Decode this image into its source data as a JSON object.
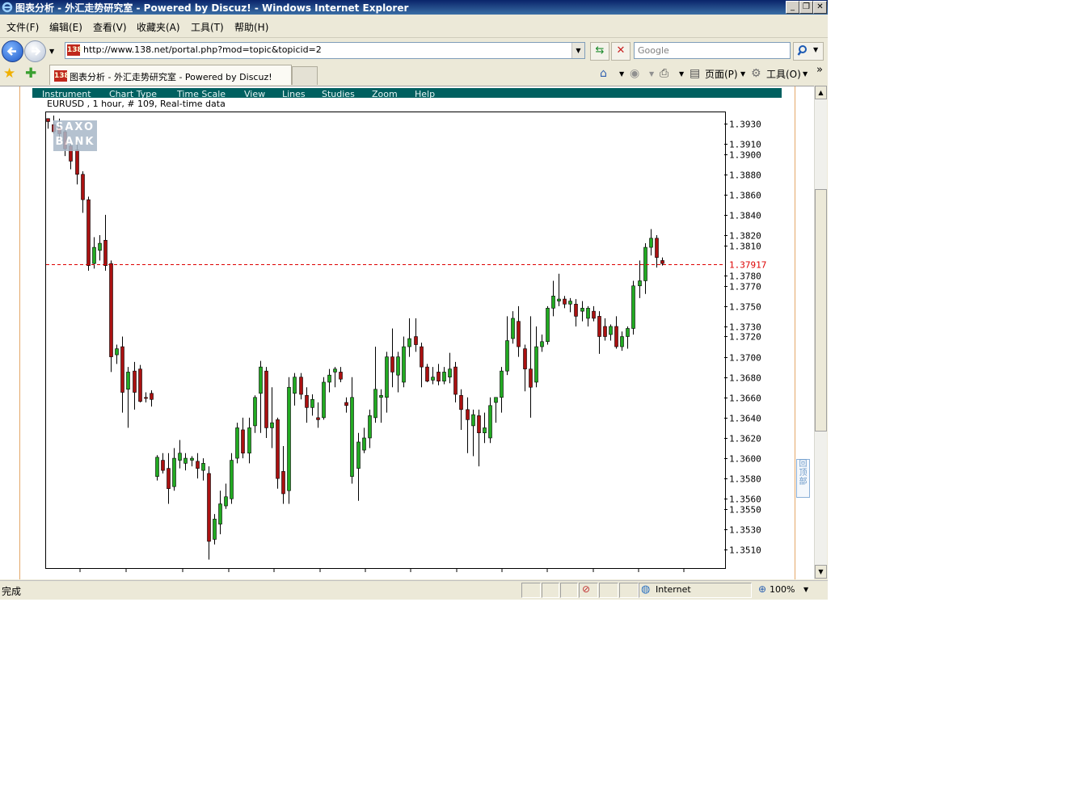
{
  "window": {
    "title": "图表分析 - 外汇走势研究室 - Powered by Discuz! - Windows Internet Explorer",
    "minimize": "_",
    "maximize": "❐",
    "close": "✕"
  },
  "menubar": {
    "items": [
      "文件(F)",
      "编辑(E)",
      "查看(V)",
      "收藏夹(A)",
      "工具(T)",
      "帮助(H)"
    ]
  },
  "address": {
    "favicon": "138",
    "url": "http://www.138.net/portal.php?mod=topic&topicid=2",
    "search_placeholder": "Google"
  },
  "tab": {
    "favicon": "138",
    "title": "图表分析 - 外汇走势研究室 - Powered by Discuz!"
  },
  "toolbar": {
    "page_label": "页面(P)",
    "tools_label": "工具(O)",
    "chevron": "»"
  },
  "icons": [
    "ie-icon",
    "back-arrow-icon",
    "forward-arrow-icon",
    "refresh-icon",
    "stop-icon",
    "search-icon",
    "favorites-star-icon",
    "add-favorites-icon",
    "home-icon",
    "feeds-icon",
    "print-icon",
    "page-icon",
    "gear-icon",
    "globe-icon",
    "zoom-icon"
  ],
  "chart_menu": [
    "Instrument",
    "Chart Type",
    "Time Scale",
    "View",
    "Lines",
    "Studies",
    "Zoom",
    "Help"
  ],
  "watermark": {
    "line1": "SAXO",
    "line2": "BANK"
  },
  "back_to_top": "回顶部",
  "status": {
    "text": "完成",
    "zone": "Internet",
    "zoom": "100%"
  },
  "colors": {
    "up": "#22aa22",
    "down": "#aa1111",
    "menu_bg": "#006060",
    "price_line": "#dd0000"
  },
  "chart_data": {
    "type": "candlestick",
    "title": "EURUSD , 1 hour, # 109, Real-time data",
    "ylim": [
      1.3497,
      1.3942
    ],
    "y_ticks": [
      "1.3930",
      "1.3910",
      "1.3900",
      "1.3880",
      "1.3860",
      "1.3840",
      "1.3820",
      "1.3810",
      "1.3780",
      "1.3770",
      "1.3750",
      "1.3730",
      "1.3720",
      "1.3700",
      "1.3680",
      "1.3660",
      "1.3640",
      "1.3620",
      "1.3600",
      "1.3580",
      "1.3560",
      "1.3550",
      "1.3530",
      "1.3510"
    ],
    "current_price": "1.37917",
    "candles": [
      {
        "o": 1.3935,
        "h": 1.3935,
        "l": 1.3925,
        "c": 1.3932
      },
      {
        "o": 1.3929,
        "h": 1.3938,
        "l": 1.392,
        "c": 1.3922
      },
      {
        "o": 1.3926,
        "h": 1.3935,
        "l": 1.3915,
        "c": 1.392
      },
      {
        "o": 1.3922,
        "h": 1.3924,
        "l": 1.3898,
        "c": 1.3905
      },
      {
        "o": 1.3908,
        "h": 1.391,
        "l": 1.3885,
        "c": 1.3893
      },
      {
        "o": 1.3904,
        "h": 1.3912,
        "l": 1.387,
        "c": 1.388
      },
      {
        "o": 1.388,
        "h": 1.3883,
        "l": 1.3842,
        "c": 1.3855
      },
      {
        "o": 1.3855,
        "h": 1.3858,
        "l": 1.3785,
        "c": 1.379
      },
      {
        "o": 1.3792,
        "h": 1.3818,
        "l": 1.3787,
        "c": 1.3808
      },
      {
        "o": 1.3805,
        "h": 1.382,
        "l": 1.3795,
        "c": 1.3812
      },
      {
        "o": 1.3815,
        "h": 1.384,
        "l": 1.3785,
        "c": 1.379
      },
      {
        "o": 1.3792,
        "h": 1.3795,
        "l": 1.3685,
        "c": 1.37
      },
      {
        "o": 1.3702,
        "h": 1.3712,
        "l": 1.3693,
        "c": 1.3708
      },
      {
        "o": 1.371,
        "h": 1.372,
        "l": 1.3645,
        "c": 1.3665
      },
      {
        "o": 1.3668,
        "h": 1.369,
        "l": 1.363,
        "c": 1.3685
      },
      {
        "o": 1.3686,
        "h": 1.3695,
        "l": 1.3648,
        "c": 1.3665
      },
      {
        "o": 1.3688,
        "h": 1.3692,
        "l": 1.3655,
        "c": 1.3656
      },
      {
        "o": 1.366,
        "h": 1.3665,
        "l": 1.3655,
        "c": 1.3659
      },
      {
        "o": 1.3664,
        "h": 1.3667,
        "l": 1.3651,
        "c": 1.3658
      },
      {
        "o": 1.3582,
        "h": 1.3603,
        "l": 1.3578,
        "c": 1.3601
      },
      {
        "o": 1.3598,
        "h": 1.3605,
        "l": 1.3585,
        "c": 1.3588
      },
      {
        "o": 1.359,
        "h": 1.3605,
        "l": 1.3555,
        "c": 1.357
      },
      {
        "o": 1.3572,
        "h": 1.361,
        "l": 1.3568,
        "c": 1.36
      },
      {
        "o": 1.3598,
        "h": 1.3618,
        "l": 1.359,
        "c": 1.3605
      },
      {
        "o": 1.3595,
        "h": 1.3605,
        "l": 1.3588,
        "c": 1.36
      },
      {
        "o": 1.3598,
        "h": 1.3602,
        "l": 1.3592,
        "c": 1.36
      },
      {
        "o": 1.3597,
        "h": 1.3605,
        "l": 1.358,
        "c": 1.359
      },
      {
        "o": 1.3588,
        "h": 1.36,
        "l": 1.3578,
        "c": 1.3595
      },
      {
        "o": 1.3585,
        "h": 1.3592,
        "l": 1.35,
        "c": 1.3518
      },
      {
        "o": 1.352,
        "h": 1.3545,
        "l": 1.3515,
        "c": 1.354
      },
      {
        "o": 1.3535,
        "h": 1.3568,
        "l": 1.3525,
        "c": 1.3555
      },
      {
        "o": 1.3553,
        "h": 1.3575,
        "l": 1.355,
        "c": 1.3562
      },
      {
        "o": 1.356,
        "h": 1.3605,
        "l": 1.3555,
        "c": 1.3598
      },
      {
        "o": 1.36,
        "h": 1.3635,
        "l": 1.3595,
        "c": 1.363
      },
      {
        "o": 1.3628,
        "h": 1.364,
        "l": 1.36,
        "c": 1.3605
      },
      {
        "o": 1.3605,
        "h": 1.364,
        "l": 1.3595,
        "c": 1.363
      },
      {
        "o": 1.3632,
        "h": 1.3662,
        "l": 1.3625,
        "c": 1.366
      },
      {
        "o": 1.3664,
        "h": 1.3696,
        "l": 1.3625,
        "c": 1.369
      },
      {
        "o": 1.3686,
        "h": 1.369,
        "l": 1.362,
        "c": 1.363
      },
      {
        "o": 1.363,
        "h": 1.367,
        "l": 1.361,
        "c": 1.3635
      },
      {
        "o": 1.3638,
        "h": 1.364,
        "l": 1.357,
        "c": 1.358
      },
      {
        "o": 1.3587,
        "h": 1.3612,
        "l": 1.3555,
        "c": 1.3565
      },
      {
        "o": 1.3568,
        "h": 1.368,
        "l": 1.3555,
        "c": 1.367
      },
      {
        "o": 1.3664,
        "h": 1.3684,
        "l": 1.3652,
        "c": 1.368
      },
      {
        "o": 1.368,
        "h": 1.3684,
        "l": 1.3658,
        "c": 1.3663
      },
      {
        "o": 1.3662,
        "h": 1.367,
        "l": 1.3635,
        "c": 1.365
      },
      {
        "o": 1.365,
        "h": 1.3663,
        "l": 1.3642,
        "c": 1.3658
      },
      {
        "o": 1.364,
        "h": 1.3655,
        "l": 1.363,
        "c": 1.3638
      },
      {
        "o": 1.364,
        "h": 1.368,
        "l": 1.3638,
        "c": 1.3675
      },
      {
        "o": 1.3675,
        "h": 1.3688,
        "l": 1.3665,
        "c": 1.3682
      },
      {
        "o": 1.3685,
        "h": 1.369,
        "l": 1.367,
        "c": 1.3688
      },
      {
        "o": 1.3685,
        "h": 1.369,
        "l": 1.3675,
        "c": 1.3678
      },
      {
        "o": 1.3655,
        "h": 1.366,
        "l": 1.3645,
        "c": 1.3652
      },
      {
        "o": 1.3582,
        "h": 1.368,
        "l": 1.3575,
        "c": 1.366
      },
      {
        "o": 1.359,
        "h": 1.3625,
        "l": 1.3558,
        "c": 1.3616
      },
      {
        "o": 1.3608,
        "h": 1.363,
        "l": 1.3605,
        "c": 1.362
      },
      {
        "o": 1.362,
        "h": 1.3648,
        "l": 1.361,
        "c": 1.3642
      },
      {
        "o": 1.364,
        "h": 1.371,
        "l": 1.3635,
        "c": 1.3668
      },
      {
        "o": 1.366,
        "h": 1.3668,
        "l": 1.3635,
        "c": 1.3662
      },
      {
        "o": 1.366,
        "h": 1.3705,
        "l": 1.3645,
        "c": 1.37
      },
      {
        "o": 1.37,
        "h": 1.3728,
        "l": 1.367,
        "c": 1.3685
      },
      {
        "o": 1.3682,
        "h": 1.3705,
        "l": 1.3665,
        "c": 1.37
      },
      {
        "o": 1.3675,
        "h": 1.372,
        "l": 1.367,
        "c": 1.371
      },
      {
        "o": 1.371,
        "h": 1.3738,
        "l": 1.37,
        "c": 1.3718
      },
      {
        "o": 1.372,
        "h": 1.3738,
        "l": 1.3705,
        "c": 1.3712
      },
      {
        "o": 1.371,
        "h": 1.3714,
        "l": 1.367,
        "c": 1.369
      },
      {
        "o": 1.369,
        "h": 1.3693,
        "l": 1.3675,
        "c": 1.3676
      },
      {
        "o": 1.3677,
        "h": 1.369,
        "l": 1.3673,
        "c": 1.368
      },
      {
        "o": 1.3685,
        "h": 1.3693,
        "l": 1.3672,
        "c": 1.3676
      },
      {
        "o": 1.3676,
        "h": 1.369,
        "l": 1.3673,
        "c": 1.3685
      },
      {
        "o": 1.368,
        "h": 1.3704,
        "l": 1.3674,
        "c": 1.3688
      },
      {
        "o": 1.369,
        "h": 1.3695,
        "l": 1.3655,
        "c": 1.3663
      },
      {
        "o": 1.3662,
        "h": 1.3668,
        "l": 1.3628,
        "c": 1.3648
      },
      {
        "o": 1.3648,
        "h": 1.366,
        "l": 1.3605,
        "c": 1.3638
      },
      {
        "o": 1.3632,
        "h": 1.3648,
        "l": 1.3602,
        "c": 1.3643
      },
      {
        "o": 1.3642,
        "h": 1.3648,
        "l": 1.3592,
        "c": 1.3625
      },
      {
        "o": 1.3625,
        "h": 1.3645,
        "l": 1.3615,
        "c": 1.363
      },
      {
        "o": 1.362,
        "h": 1.366,
        "l": 1.3615,
        "c": 1.3652
      },
      {
        "o": 1.3655,
        "h": 1.366,
        "l": 1.3635,
        "c": 1.366
      },
      {
        "o": 1.366,
        "h": 1.369,
        "l": 1.3645,
        "c": 1.3686
      },
      {
        "o": 1.3686,
        "h": 1.374,
        "l": 1.3682,
        "c": 1.3716
      },
      {
        "o": 1.3718,
        "h": 1.3745,
        "l": 1.3713,
        "c": 1.3738
      },
      {
        "o": 1.3735,
        "h": 1.375,
        "l": 1.37,
        "c": 1.371
      },
      {
        "o": 1.3708,
        "h": 1.3712,
        "l": 1.3666,
        "c": 1.3688
      },
      {
        "o": 1.3688,
        "h": 1.374,
        "l": 1.364,
        "c": 1.367
      },
      {
        "o": 1.3675,
        "h": 1.373,
        "l": 1.367,
        "c": 1.371
      },
      {
        "o": 1.371,
        "h": 1.3722,
        "l": 1.3705,
        "c": 1.3715
      },
      {
        "o": 1.3715,
        "h": 1.375,
        "l": 1.3712,
        "c": 1.3748
      },
      {
        "o": 1.3748,
        "h": 1.3775,
        "l": 1.374,
        "c": 1.376
      },
      {
        "o": 1.3755,
        "h": 1.3782,
        "l": 1.375,
        "c": 1.3757
      },
      {
        "o": 1.3757,
        "h": 1.376,
        "l": 1.3748,
        "c": 1.3752
      },
      {
        "o": 1.3752,
        "h": 1.3758,
        "l": 1.3744,
        "c": 1.3755
      },
      {
        "o": 1.3752,
        "h": 1.3757,
        "l": 1.373,
        "c": 1.374
      },
      {
        "o": 1.3745,
        "h": 1.3755,
        "l": 1.3735,
        "c": 1.3748
      },
      {
        "o": 1.3738,
        "h": 1.375,
        "l": 1.373,
        "c": 1.3748
      },
      {
        "o": 1.3745,
        "h": 1.375,
        "l": 1.3735,
        "c": 1.3738
      },
      {
        "o": 1.374,
        "h": 1.3745,
        "l": 1.3703,
        "c": 1.372
      },
      {
        "o": 1.373,
        "h": 1.3738,
        "l": 1.3716,
        "c": 1.372
      },
      {
        "o": 1.3722,
        "h": 1.3732,
        "l": 1.3716,
        "c": 1.373
      },
      {
        "o": 1.373,
        "h": 1.374,
        "l": 1.3708,
        "c": 1.371
      },
      {
        "o": 1.371,
        "h": 1.3725,
        "l": 1.3706,
        "c": 1.372
      },
      {
        "o": 1.372,
        "h": 1.373,
        "l": 1.3708,
        "c": 1.3728
      },
      {
        "o": 1.3728,
        "h": 1.3775,
        "l": 1.3722,
        "c": 1.377
      },
      {
        "o": 1.377,
        "h": 1.3795,
        "l": 1.3758,
        "c": 1.3775
      },
      {
        "o": 1.3775,
        "h": 1.3812,
        "l": 1.3762,
        "c": 1.3808
      },
      {
        "o": 1.3808,
        "h": 1.3826,
        "l": 1.38,
        "c": 1.3817
      },
      {
        "o": 1.3817,
        "h": 1.382,
        "l": 1.3788,
        "c": 1.3798
      },
      {
        "o": 1.3795,
        "h": 1.3798,
        "l": 1.379,
        "c": 1.3792
      }
    ]
  }
}
